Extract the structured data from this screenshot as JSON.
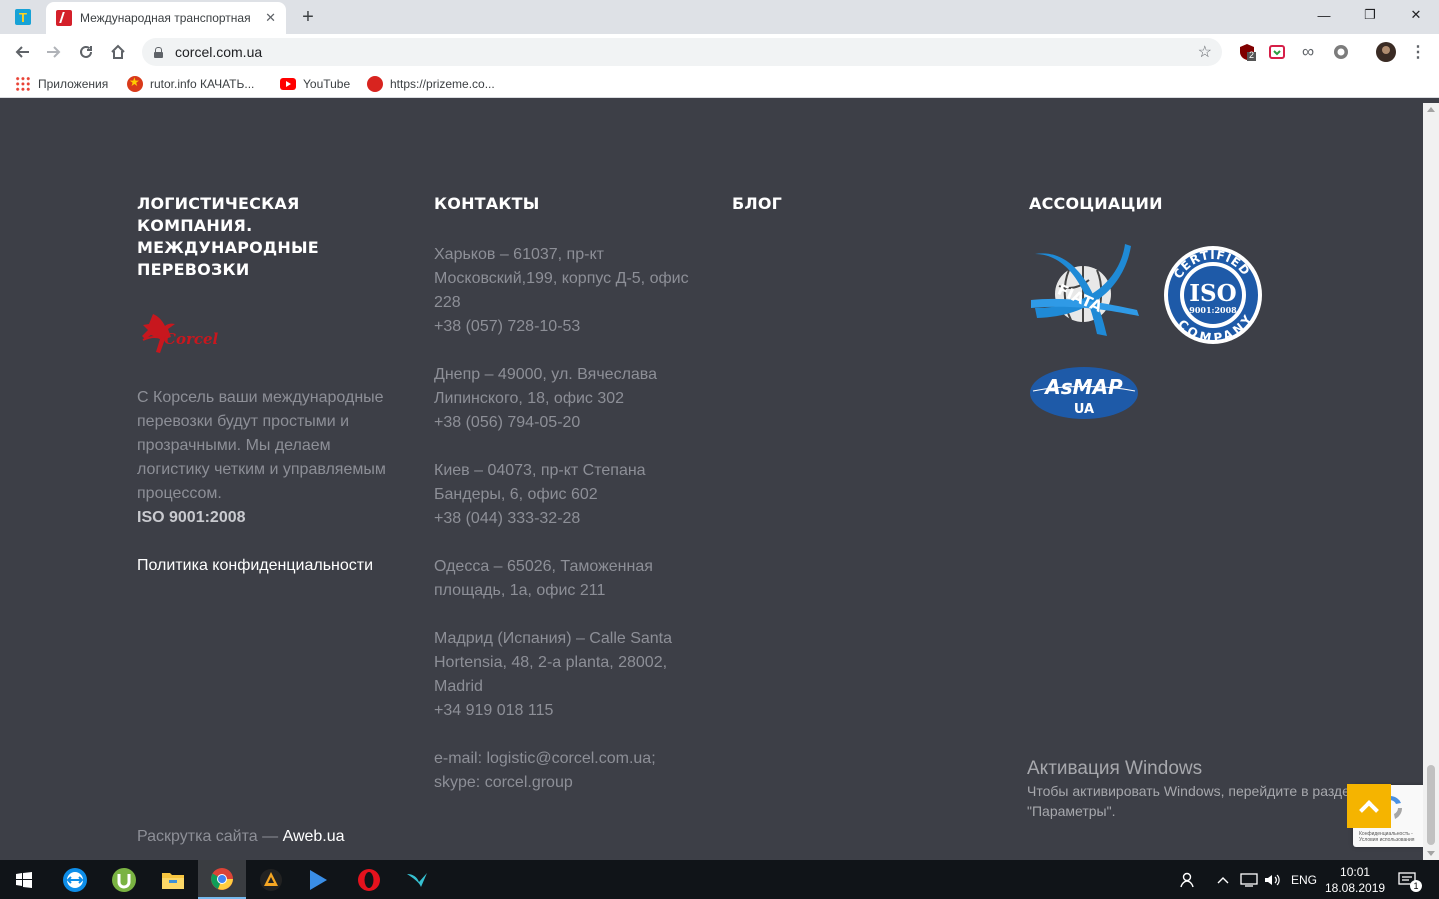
{
  "browser": {
    "pinned_tab_letter": "T",
    "active_tab_title": "Международная транспортная",
    "tab_close": "✕",
    "new_tab": "+",
    "window_controls": {
      "minimize": "—",
      "maximize": "❐",
      "close": "✕"
    },
    "url": "corcel.com.ua",
    "extension_badge": "2",
    "bookmarks": [
      {
        "label": "Приложения",
        "icon": "apps-icon"
      },
      {
        "label": "rutor.info КАЧАТЬ...",
        "icon": "rutor-icon"
      },
      {
        "label": "YouTube",
        "icon": "youtube-icon"
      },
      {
        "label": "https://prizeme.co...",
        "icon": "prizeme-icon"
      }
    ]
  },
  "footer": {
    "col1": {
      "title": "ЛОГИСТИЧЕСКАЯ КОМПАНИЯ. МЕЖДУНАРОДНЫЕ ПЕРЕВОЗКИ",
      "logo_text": "Corcel",
      "description": "С Корсель ваши международные перевозки будут простыми и прозрачными. Мы делаем логистику четким и управляемым процессом.",
      "iso": "ISO 9001:2008",
      "privacy_link": "Политика конфиденциальности"
    },
    "col2": {
      "title": "КОНТАКТЫ",
      "offices": [
        {
          "address": "Харьков – 61037, пр-кт Московский,199, корпус Д-5, офис 228",
          "phone": "+38 (057) 728-10-53"
        },
        {
          "address": "Днепр – 49000, ул. Вячеслава Липинского, 18, офис 302",
          "phone": "+38 (056) 794-05-20"
        },
        {
          "address": "Киев – 04073, пр-кт Степана Бандеры, 6, офис 602",
          "phone": "+38 (044) 333-32-28"
        },
        {
          "address": "Одесса – 65026, Таможенная площадь, 1а, офис 211",
          "phone": ""
        },
        {
          "address": "Мадрид (Испания) – Calle Santa Hortensia, 48, 2-a planta, 28002, Madrid",
          "phone": "+34 919 018 115"
        }
      ],
      "email": "e-mail: logistic@corcel.com.ua;",
      "skype": "skype: corcel.group"
    },
    "col3": {
      "title": "БЛОГ"
    },
    "col4": {
      "title": "АССОЦИАЦИИ",
      "fiata_text": "FIATA",
      "iso_top": "CERTIFIED",
      "iso_mid": "ISO",
      "iso_num": "9001:2008",
      "iso_bottom": "COMPANY",
      "asmap_text": "AsMAP",
      "asmap_sub": "UA"
    },
    "promo_prefix": "Раскрутка сайта — ",
    "promo_link": "Aweb.ua"
  },
  "windows_activation": {
    "title": "Активация Windows",
    "line1": "Чтобы активировать Windows, перейдите в раздел",
    "line2": "\"Параметры\"."
  },
  "recaptcha_legal": "Конфиденциальность - Условия использования",
  "taskbar": {
    "language": "ENG",
    "time": "10:01",
    "date": "18.08.2019",
    "notification_count": "1"
  },
  "colors": {
    "page_bg": "#3d3f47",
    "accent_yellow": "#f5b400",
    "muted_text": "#8d8f97",
    "corcel_red": "#c8171e",
    "assoc_blue": "#1e5aa8"
  }
}
